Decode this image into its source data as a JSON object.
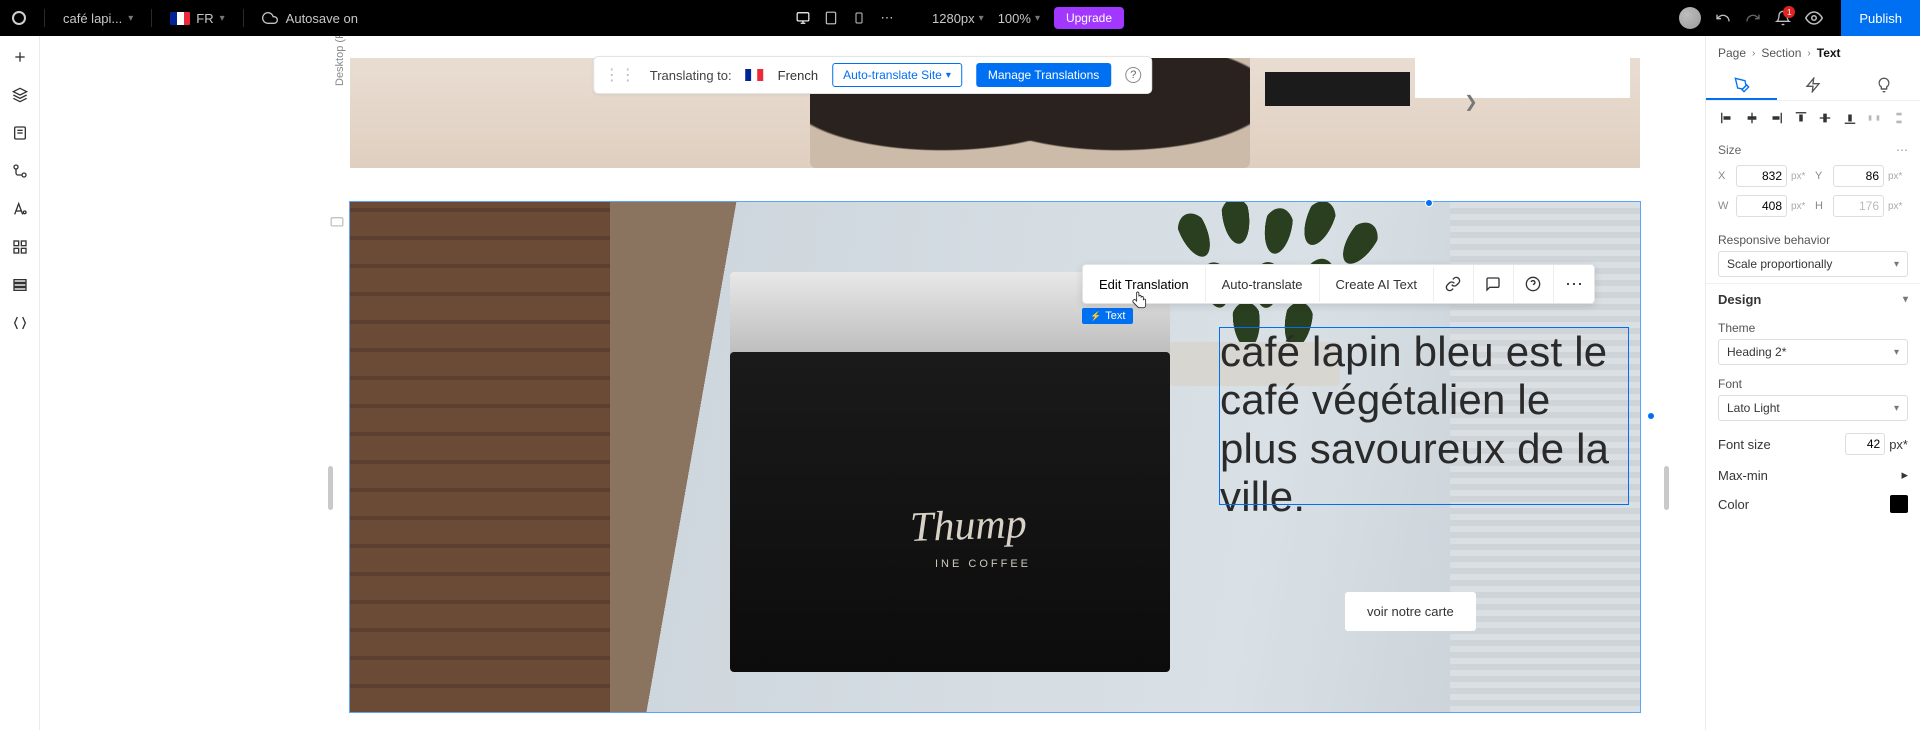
{
  "topbar": {
    "project_name": "café lapi...",
    "locale_code": "FR",
    "autosave": "Autosave on",
    "viewport": "1280px",
    "zoom": "100%",
    "upgrade": "Upgrade",
    "notifications_badge": "1",
    "publish": "Publish"
  },
  "translation_bar": {
    "label": "Translating to:",
    "language": "French",
    "auto_translate_site": "Auto-translate Site",
    "manage_translations": "Manage Translations"
  },
  "breakpoint_label": "Desktop (Primary)",
  "element_toolbar": {
    "edit_translation": "Edit Translation",
    "auto_translate": "Auto-translate",
    "create_ai_text": "Create AI Text"
  },
  "selection_tag": "Text",
  "section2": {
    "headline": "café lapin bleu est le café végétalien le plus savoureux de la ville.",
    "cta": "voir notre carte",
    "machine_logo": "Thump",
    "machine_sub": "INE COFFEE"
  },
  "rpanel": {
    "breadcrumbs": {
      "page": "Page",
      "section": "Section",
      "current": "Text"
    },
    "tabs": {
      "design": "design",
      "animate": "animate",
      "inspect": "inspect"
    },
    "size_header": "Size",
    "size": {
      "x": "832",
      "y": "86",
      "w": "408",
      "h": "176"
    },
    "units": "px*",
    "responsive_label": "Responsive behavior",
    "responsive_value": "Scale proportionally",
    "design_header": "Design",
    "theme_label": "Theme",
    "theme_value": "Heading 2*",
    "font_label": "Font",
    "font_value": "Lato Light",
    "fontsize_label": "Font size",
    "fontsize_value": "42",
    "maxmin_label": "Max-min",
    "color_label": "Color",
    "color_value": "#000000"
  }
}
